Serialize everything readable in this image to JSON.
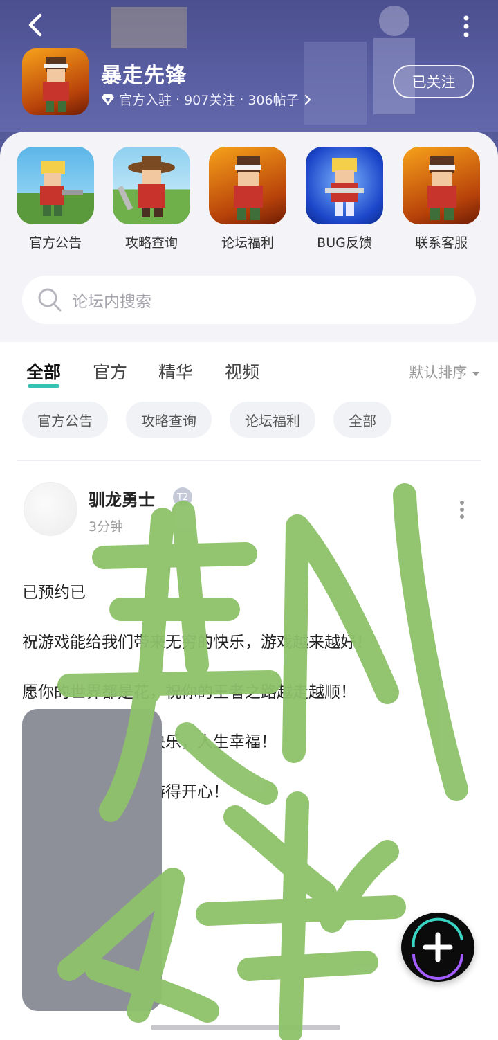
{
  "header": {
    "title": "暴走先锋",
    "verified_icon": "diamond-icon",
    "meta_official": "官方入驻",
    "meta_sep1": "·",
    "meta_follows": "907关注",
    "meta_sep2": "·",
    "meta_posts": "306帖子",
    "follow_button": "已关注",
    "back_icon": "chevron-left-icon",
    "more_icon": "vertical-dots-icon"
  },
  "shortcuts": [
    {
      "label": "官方公告"
    },
    {
      "label": "攻略查询"
    },
    {
      "label": "论坛福利"
    },
    {
      "label": "BUG反馈"
    },
    {
      "label": "联系客服"
    }
  ],
  "search": {
    "placeholder": "论坛内搜索"
  },
  "tabs": [
    {
      "label": "全部",
      "active": true
    },
    {
      "label": "官方"
    },
    {
      "label": "精华"
    },
    {
      "label": "视频"
    }
  ],
  "sort": {
    "label": "默认排序",
    "icon": "caret-down-icon"
  },
  "chips": [
    {
      "label": "官方公告"
    },
    {
      "label": "攻略查询"
    },
    {
      "label": "论坛福利"
    },
    {
      "label": "全部"
    }
  ],
  "post": {
    "author": "驯龙勇士",
    "level": "T2",
    "time": "3分钟",
    "lines": [
      "已预约已",
      "祝游戏能给我们带来无穷的快乐，游戏越来越好！",
      "愿你的世界都是花，祝你的王者之路越走越顺！",
      "祝愿玩家朋友游戏快乐，人生幸福！",
      "祝大家玩得愉快，游得开心！"
    ]
  },
  "fab": {
    "icon": "plus-icon"
  },
  "colors": {
    "header_bg": "#5a5fa3",
    "accent": "#36c3b5",
    "scribble": "#8ec26a"
  }
}
